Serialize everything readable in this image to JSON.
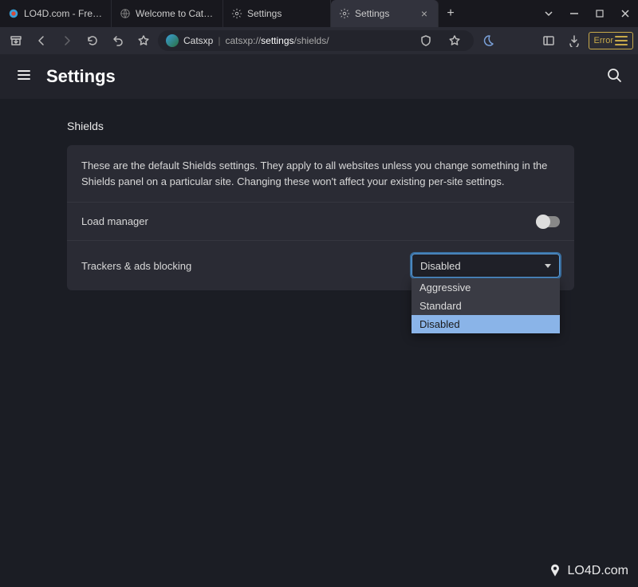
{
  "tabs": [
    {
      "label": "LO4D.com - Free Sof"
    },
    {
      "label": "Welcome to Catsxp"
    },
    {
      "label": "Settings"
    },
    {
      "label": "Settings"
    }
  ],
  "address": {
    "brand": "Catsxp",
    "url_prefix": "catsxp://",
    "url_bold": "settings",
    "url_rest": "/shields/"
  },
  "error_label": "Error",
  "page": {
    "title": "Settings",
    "section": "Shields",
    "description": "These are the default Shields settings. They apply to all websites unless you change something in the Shields panel on a particular site. Changing these won't affect your existing per-site settings.",
    "rows": {
      "load_manager": "Load manager",
      "trackers": "Trackers & ads blocking"
    },
    "select": {
      "value": "Disabled",
      "options": [
        "Aggressive",
        "Standard",
        "Disabled"
      ]
    }
  },
  "watermark": "LO4D.com"
}
